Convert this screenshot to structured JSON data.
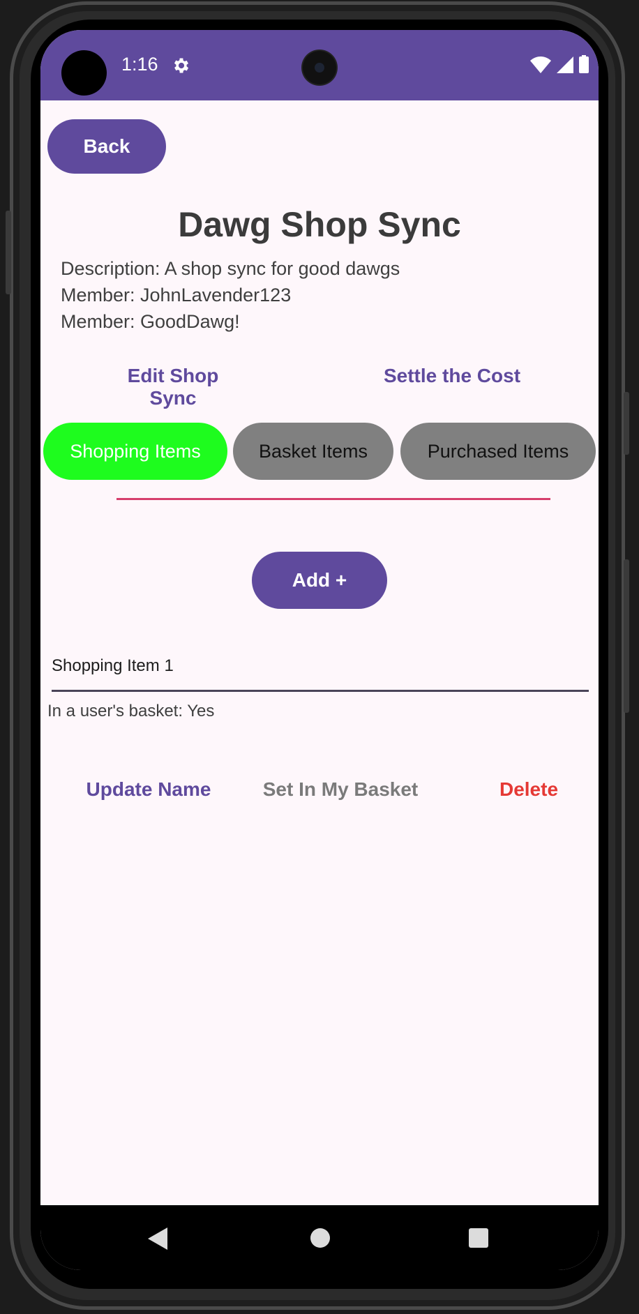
{
  "status_bar": {
    "time": "1:16",
    "icons": [
      "settings-gear-icon",
      "wifi-icon",
      "cellular-signal-icon",
      "battery-icon"
    ]
  },
  "header": {
    "back_label": "Back",
    "title": "Dawg Shop Sync"
  },
  "details": {
    "description": "Description: A shop sync for good dawgs",
    "members": [
      "Member: JohnLavender123",
      "Member: GoodDawg!"
    ]
  },
  "actions": {
    "edit_label": "Edit Shop Sync",
    "settle_label": "Settle the Cost"
  },
  "tabs": [
    {
      "label": "Shopping Items",
      "active": true
    },
    {
      "label": "Basket Items",
      "active": false
    },
    {
      "label": "Purchased Items",
      "active": false
    }
  ],
  "add_label": "Add +",
  "items": [
    {
      "name": "Shopping Item 1",
      "basket_status": "In a user's basket: Yes",
      "update_label": "Update Name",
      "basket_label": "Set In My Basket",
      "delete_label": "Delete"
    }
  ],
  "colors": {
    "primary": "#5f4a9d",
    "active_tab": "#1efc1e",
    "inactive_tab": "#808080",
    "delete": "#e53935",
    "disabled_text": "#7a7a7a",
    "indicator": "#d63e6c",
    "background": "#fef7fb"
  }
}
